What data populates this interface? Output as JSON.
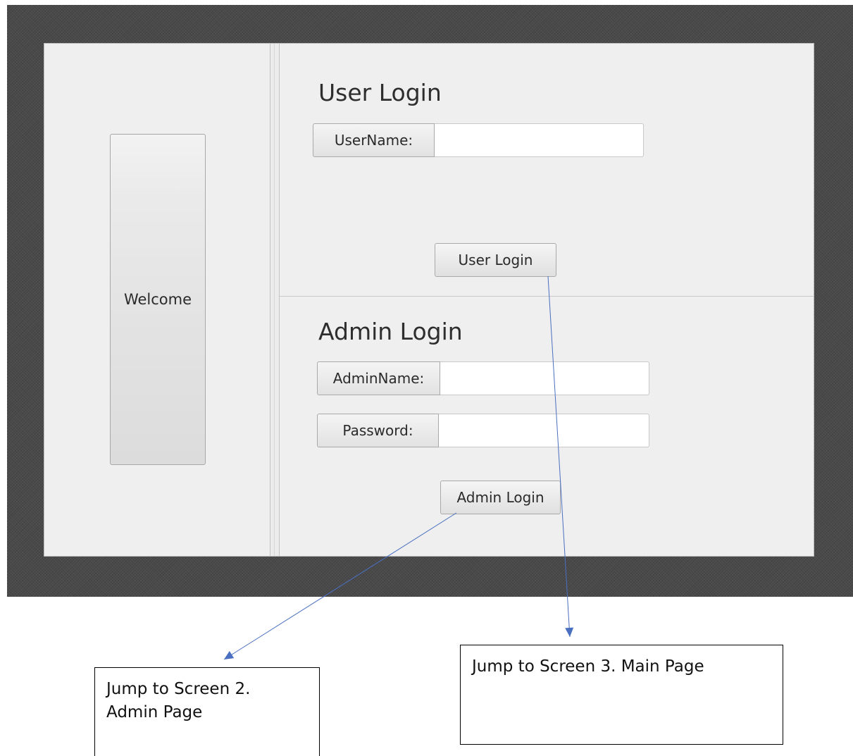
{
  "left_panel": {
    "welcome_label": "Welcome"
  },
  "user_section": {
    "heading": "User Login",
    "username_label": "UserName:",
    "username_value": "",
    "login_button": "User Login"
  },
  "admin_section": {
    "heading": "Admin Login",
    "adminname_label": "AdminName:",
    "adminname_value": "",
    "password_label": "Password:",
    "password_value": "",
    "login_button": "Admin Login"
  },
  "annotations": {
    "admin_note": "Jump to Screen 2.\nAdmin Page",
    "main_note": "Jump to Screen 3. Main Page",
    "arrow_color": "#4a6fc1"
  }
}
